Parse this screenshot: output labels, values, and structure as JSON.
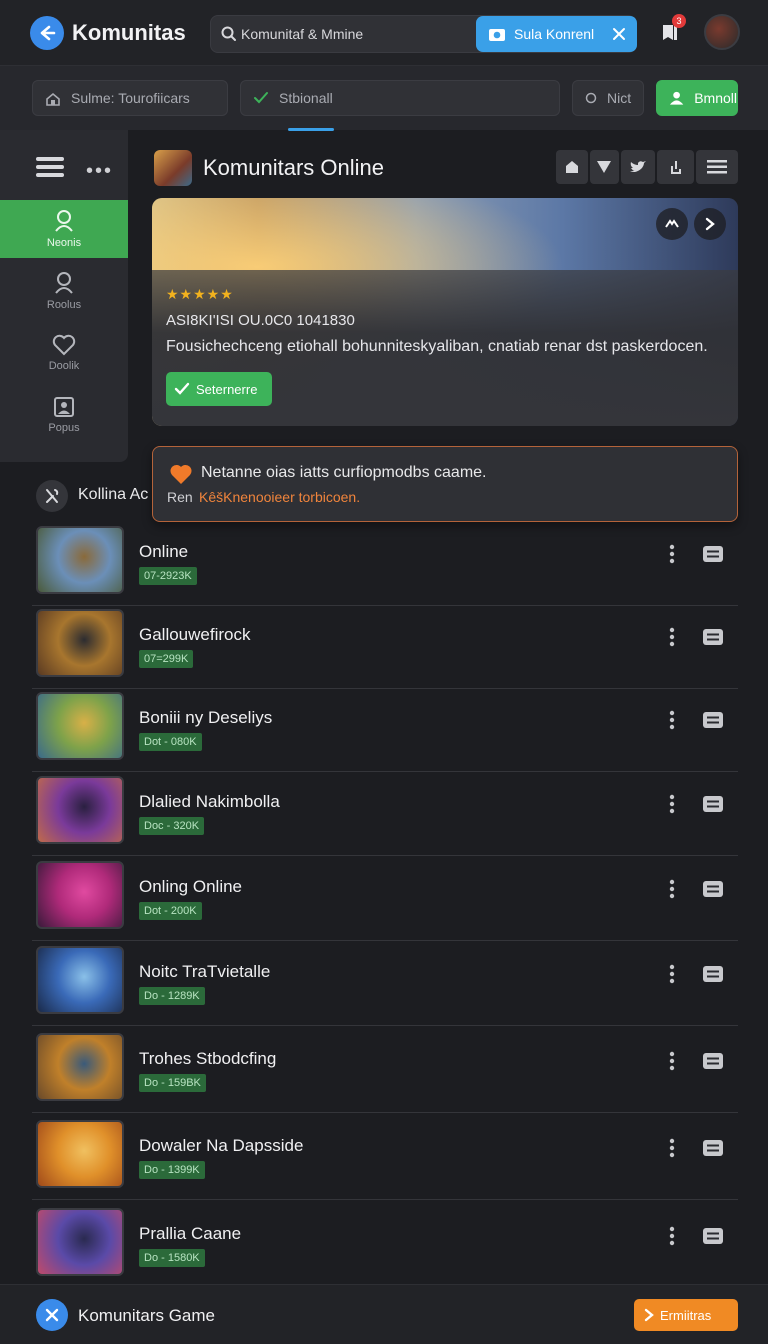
{
  "header": {
    "app_title": "Komunitas",
    "search_value": "Komunitaf & Mmine",
    "search_button": "Sula Konrenl",
    "notification_count": "3"
  },
  "filters": {
    "name_filter": "Sulme: Tourofiicars",
    "status_filter": "Stbionall",
    "toggle_option": "Nict",
    "primary_action": "Bmnoll"
  },
  "sidebar": {
    "items": [
      {
        "label": "Neonis",
        "icon": "user-icon",
        "active": true
      },
      {
        "label": "Roolus",
        "icon": "user-icon",
        "active": false
      },
      {
        "label": "Doolik",
        "icon": "heart-icon",
        "active": false
      },
      {
        "label": "Popus",
        "icon": "image-icon",
        "active": false
      }
    ]
  },
  "featured": {
    "title": "Komunitars Online",
    "rating": "★★★★★",
    "meta": "ASI8KI'ISI OU.0C0 1041830",
    "description": "Fousichechceng etiohall bohunniteskyaliban, cnatiab renar dst paskerdocen.",
    "action_label": "Seternerre"
  },
  "tip": {
    "message": "Netanne oias iatts curfiopmodbs caame.",
    "prefix": "Ren",
    "link": "KêšKnenooieer torbicoen."
  },
  "section": {
    "title": "Kollina Ac"
  },
  "games": [
    {
      "name": "Online",
      "stat": "07-2923K",
      "colors": [
        "#6b8fb8",
        "#4a5a3a",
        "#8a6a3a"
      ]
    },
    {
      "name": "Gallouwefirock",
      "stat": "07=299K",
      "colors": [
        "#a8762e",
        "#5a3a22",
        "#2c2c30"
      ]
    },
    {
      "name": "Boniii ny Deseliys",
      "stat": "Dot - 080K",
      "colors": [
        "#7ea24a",
        "#3a6a8a",
        "#d8b048"
      ]
    },
    {
      "name": "Dlalied Nakimbolla",
      "stat": "Doc - 320K",
      "colors": [
        "#7a3a9a",
        "#c06a4a",
        "#2a2040"
      ]
    },
    {
      "name": "Onling Online",
      "stat": "Dot - 200K",
      "colors": [
        "#b02a7a",
        "#3a1a3a",
        "#e04aa0"
      ]
    },
    {
      "name": "Noitc TraTvietalle",
      "stat": "Do - 1289K",
      "colors": [
        "#3a6ab8",
        "#1a2a4a",
        "#8ac0e8"
      ]
    },
    {
      "name": "Trohes Stbodcfing",
      "stat": "Do - 159BK",
      "colors": [
        "#c0802a",
        "#6a4a2a",
        "#3a5a7a"
      ]
    },
    {
      "name": "Dowaler Na Dapsside",
      "stat": "Do - 1399K",
      "colors": [
        "#e0902a",
        "#a04a1a",
        "#f0c060"
      ]
    },
    {
      "name": "Prallia Caane",
      "stat": "Do - 1580K",
      "colors": [
        "#5a4aa8",
        "#c04a6a",
        "#2a2a50"
      ]
    }
  ],
  "bottom": {
    "title": "Komunitars Game",
    "action": "Ermiitras"
  }
}
